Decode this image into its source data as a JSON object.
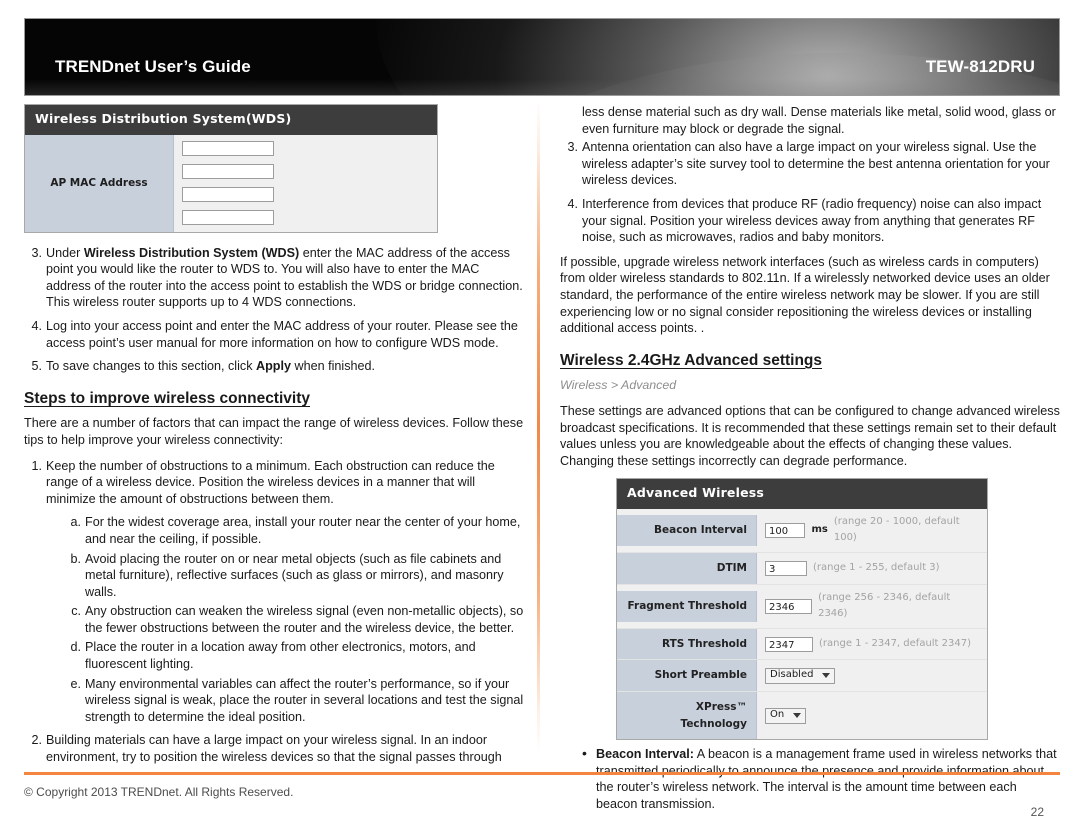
{
  "header": {
    "title": "TRENDnet User’s Guide",
    "model": "TEW-812DRU"
  },
  "footer": {
    "copyright": "© Copyright 2013 TRENDnet. All Rights Reserved.",
    "page_number": "22"
  },
  "colors": {
    "accent_orange": "#f3853f",
    "panel_title_bar": "#3d3d3d",
    "panel_label_cell": "#c8d0dc",
    "panel_body": "#f0f0f0",
    "hint_text": "#a3a3a3"
  },
  "wds_panel": {
    "title": "Wireless Distribution System(WDS)",
    "label": "AP MAC Address",
    "inputs": [
      "",
      "",
      "",
      ""
    ],
    "input_count": 4
  },
  "advanced_panel": {
    "title": "Advanced Wireless",
    "rows": [
      {
        "label": "Beacon Interval",
        "value": "100",
        "unit": "ms",
        "hint": "(range 20 - 1000, default 100)",
        "control": "input"
      },
      {
        "label": "DTIM",
        "value": "3",
        "unit": "",
        "hint": "(range 1 - 255, default 3)",
        "control": "input"
      },
      {
        "label": "Fragment Threshold",
        "value": "2346",
        "unit": "",
        "hint": "(range 256 - 2346, default 2346)",
        "control": "input"
      },
      {
        "label": "RTS Threshold",
        "value": "2347",
        "unit": "",
        "hint": "(range 1 - 2347, default 2347)",
        "control": "input"
      },
      {
        "label": "Short Preamble",
        "value": "Disabled",
        "unit": "",
        "hint": "",
        "control": "select"
      },
      {
        "label": "XPress™ Technology",
        "value": "On",
        "unit": "",
        "hint": "",
        "control": "select"
      }
    ]
  },
  "left_column": {
    "wds_steps": [
      {
        "marker": "3.",
        "pre": "Under ",
        "bold": "Wireless Distribution System (WDS)",
        "post": " enter the MAC address of the access point you would like the router to WDS to. You will also have to enter the MAC address of the router into the access point to establish the WDS or bridge connection. This wireless router supports up to 4 WDS connections."
      },
      {
        "marker": "4.",
        "pre": "Log into your access point and enter the MAC address of your router. Please see the access point’s user manual for more information on how to configure WDS mode.",
        "bold": "",
        "post": ""
      },
      {
        "marker": "5.",
        "pre": "To save changes to this section, click ",
        "bold": "Apply",
        "post": " when finished."
      }
    ],
    "steps_heading": "Steps to improve wireless connectivity",
    "steps_intro": "There are a number of factors that can impact the range of wireless devices. Follow these tips to help improve your wireless connectivity:",
    "tips": [
      {
        "marker": "1.",
        "text": "Keep the number of obstructions to a minimum. Each obstruction can reduce the range of a wireless device.  Position the wireless devices in a manner that will minimize the amount of obstructions between them.",
        "sub": [
          {
            "marker": "a.",
            "text": "For the widest coverage area, install your router near the center of your home, and near the ceiling, if possible."
          },
          {
            "marker": "b.",
            "text": "Avoid placing the router on or near metal objects (such as file cabinets and metal furniture), reflective surfaces (such as glass or mirrors), and masonry walls."
          },
          {
            "marker": "c.",
            "text": "Any obstruction can weaken the wireless signal (even non-metallic objects), so the fewer obstructions between the router and the wireless device, the better."
          },
          {
            "marker": "d.",
            "text": "Place the router in a location away from other electronics, motors, and fluorescent lighting."
          },
          {
            "marker": "e.",
            "text": "Many environmental variables can affect the router’s performance, so if your wireless signal is weak, place the router in several locations and test the signal strength to determine the ideal position."
          }
        ]
      },
      {
        "marker": "2.",
        "text": "Building materials can have a large impact on your wireless signal. In an indoor environment, try to position the wireless devices so that the signal passes through",
        "sub": []
      }
    ]
  },
  "right_column": {
    "continued_text": "less dense material such as dry wall.  Dense materials like metal, solid wood, glass or even furniture may block or degrade the signal.",
    "tips": [
      {
        "marker": "3.",
        "text": "Antenna orientation can also have a large impact on your wireless signal. Use the wireless adapter’s site survey tool to determine the best antenna orientation for your wireless devices."
      },
      {
        "marker": "4.",
        "text": "Interference from devices that produce RF (radio frequency) noise can also impact your signal. Position your wireless devices away from anything that generates RF noise, such as microwaves, radios and baby monitors."
      }
    ],
    "upgrade_paragraph": "If possible, upgrade wireless network interfaces (such as wireless cards in computers) from older wireless standards to 802.11n. If a wirelessly networked device uses an older standard, the performance of the entire wireless network may be slower. If you are still experiencing low or no signal consider repositioning the wireless devices or installing additional access points. .",
    "advanced_heading": "Wireless 2.4GHz Advanced settings",
    "advanced_subtitle": "Wireless > Advanced",
    "advanced_paragraph": "These settings are advanced options that can be configured to change advanced wireless broadcast specifications. It is recommended that these settings remain set to their default values unless you are knowledgeable about the effects of changing these values. Changing these settings incorrectly can degrade performance.",
    "bullets": [
      {
        "marker": "•",
        "bold": "Beacon Interval:",
        "text": " A beacon is a management frame used in wireless networks that transmitted periodically to announce the presence and provide information about the router’s wireless network. The interval is the amount time between each beacon transmission."
      }
    ]
  }
}
